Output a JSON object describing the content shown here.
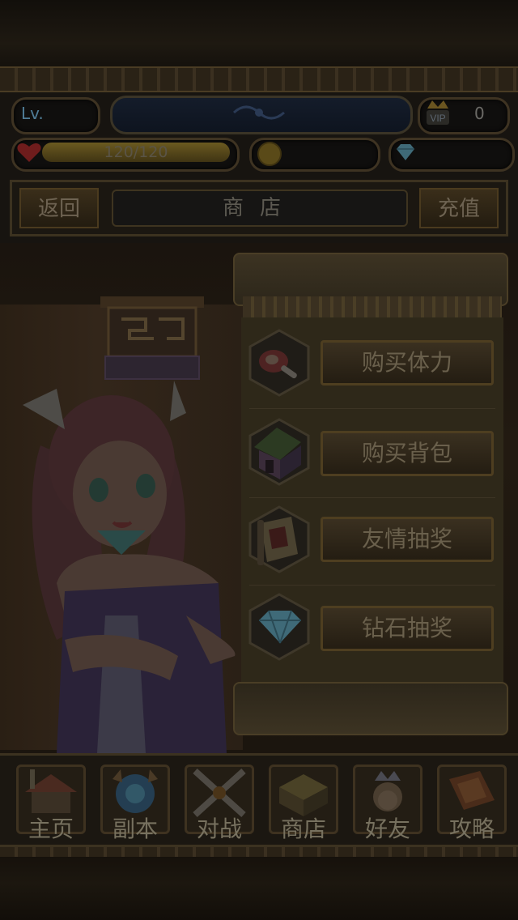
{
  "status": {
    "level_label": "Lv.",
    "vip_label": "VIP",
    "vip_value": "0",
    "hp_text": "120/120",
    "hp_fraction": 1.0
  },
  "nav": {
    "back_label": "返回",
    "title": "商店",
    "recharge_label": "充值"
  },
  "shop": {
    "items": [
      {
        "label": "购买体力",
        "icon": "meat-icon"
      },
      {
        "label": "购买背包",
        "icon": "house-icon"
      },
      {
        "label": "友情抽奖",
        "icon": "scroll-icon"
      },
      {
        "label": "钻石抽奖",
        "icon": "diamond-icon"
      }
    ]
  },
  "tabs": [
    {
      "label": "主页",
      "icon": "home-icon"
    },
    {
      "label": "副本",
      "icon": "dungeon-icon"
    },
    {
      "label": "对战",
      "icon": "crossed-swords-icon"
    },
    {
      "label": "商店",
      "icon": "shop-icon"
    },
    {
      "label": "好友",
      "icon": "friend-icon"
    },
    {
      "label": "攻略",
      "icon": "guide-book-icon"
    }
  ],
  "colors": {
    "overlay_tint": "#000000",
    "hp_bar": "#6b5a20",
    "gem": "#3f6a78"
  }
}
